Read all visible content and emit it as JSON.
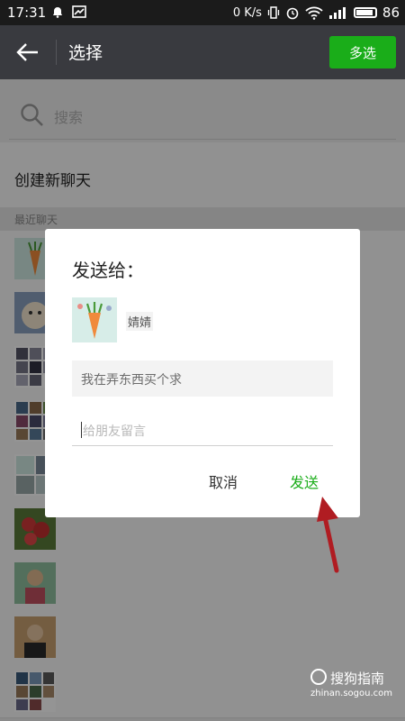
{
  "status_bar": {
    "time": "17:31",
    "network_speed": "0 K/s",
    "battery": "86"
  },
  "app_bar": {
    "title": "选择",
    "multi_select_label": "多选"
  },
  "search": {
    "placeholder": "搜索"
  },
  "new_chat": {
    "label": "创建新聊天"
  },
  "recent_section": {
    "header": "最近聊天"
  },
  "dialog": {
    "title": "发送给：",
    "recipient_name": "婧婧",
    "message_preview": "我在弄东西买个求",
    "note_placeholder": "给朋友留言",
    "cancel_label": "取消",
    "send_label": "发送"
  },
  "watermark": {
    "brand": "搜狗指南",
    "url": "zhinan.sogou.com"
  },
  "colors": {
    "accent_green": "#1aad19",
    "appbar": "#393a3f",
    "annotation_arrow": "#b01c22"
  }
}
